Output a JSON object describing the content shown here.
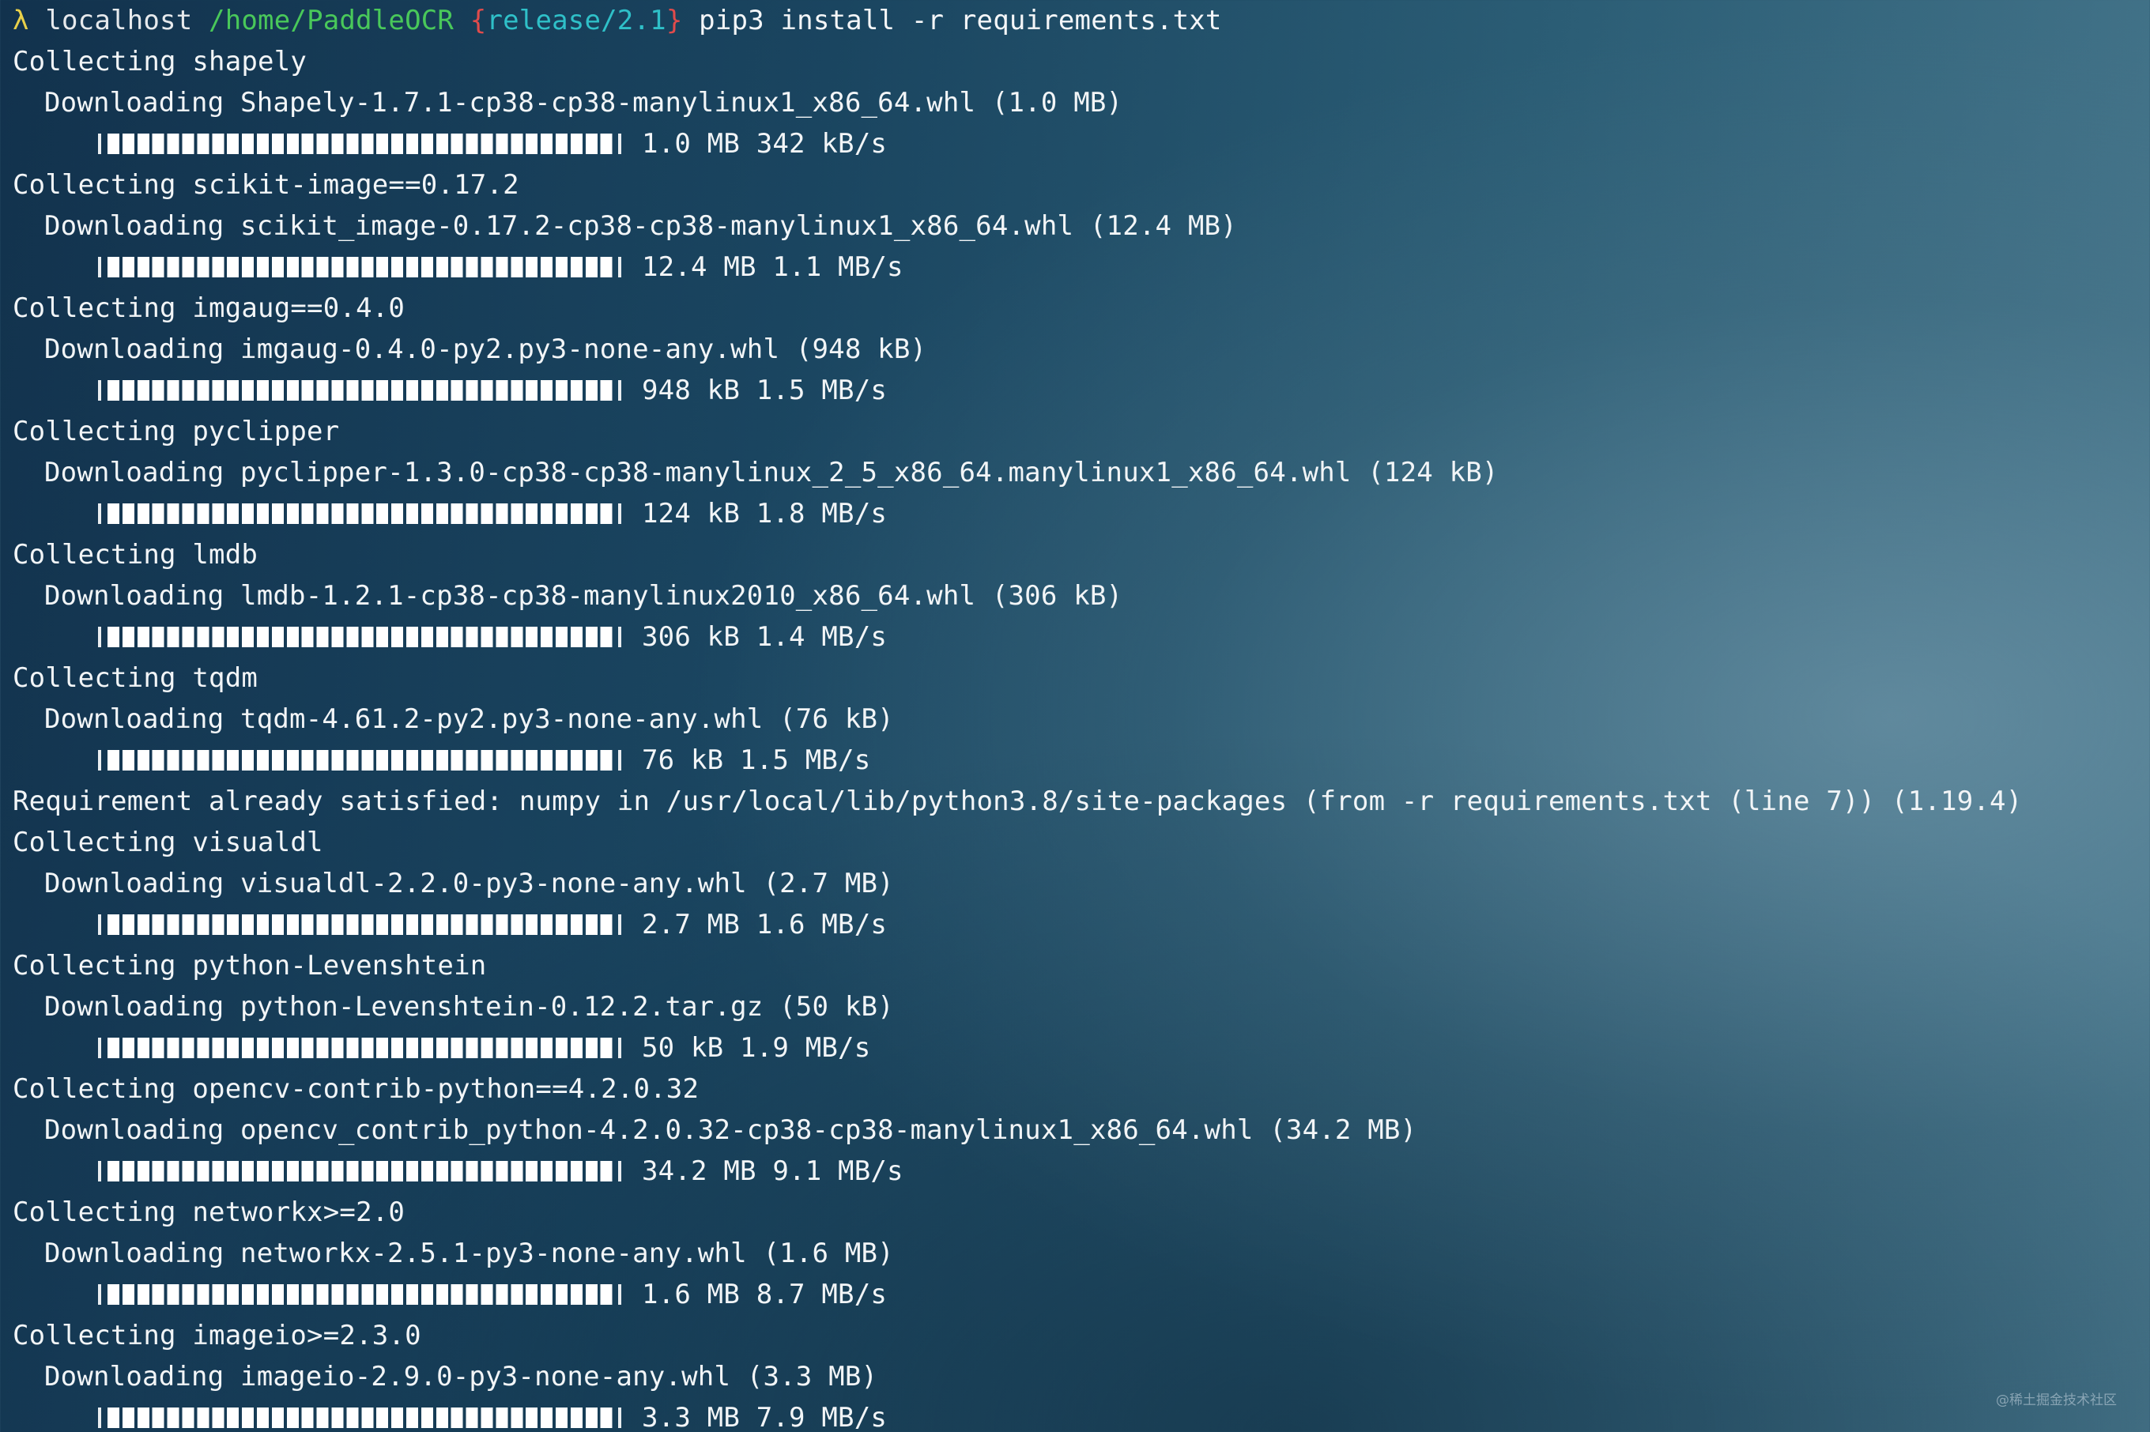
{
  "prompt": {
    "lambda": "λ",
    "host": "localhost",
    "path": "/home/PaddleOCR",
    "brace_open": "{",
    "branch": "release/2.1",
    "brace_close": "}",
    "command": "pip3 install -r requirements.txt"
  },
  "lines": [
    {
      "type": "collect",
      "text": "Collecting shapely"
    },
    {
      "type": "download",
      "text": "Downloading Shapely-1.7.1-cp38-cp38-manylinux1_x86_64.whl (1.0 MB)"
    },
    {
      "type": "bar",
      "stats": "1.0 MB 342 kB/s",
      "progress": 1.0
    },
    {
      "type": "collect",
      "text": "Collecting scikit-image==0.17.2"
    },
    {
      "type": "download",
      "text": "Downloading scikit_image-0.17.2-cp38-cp38-manylinux1_x86_64.whl (12.4 MB)"
    },
    {
      "type": "bar",
      "stats": "12.4 MB 1.1 MB/s",
      "progress": 1.0
    },
    {
      "type": "collect",
      "text": "Collecting imgaug==0.4.0"
    },
    {
      "type": "download",
      "text": "Downloading imgaug-0.4.0-py2.py3-none-any.whl (948 kB)"
    },
    {
      "type": "bar",
      "stats": "948 kB 1.5 MB/s",
      "progress": 1.0
    },
    {
      "type": "collect",
      "text": "Collecting pyclipper"
    },
    {
      "type": "download",
      "text": "Downloading pyclipper-1.3.0-cp38-cp38-manylinux_2_5_x86_64.manylinux1_x86_64.whl (124 kB)"
    },
    {
      "type": "bar",
      "stats": "124 kB 1.8 MB/s",
      "progress": 1.0
    },
    {
      "type": "collect",
      "text": "Collecting lmdb"
    },
    {
      "type": "download",
      "text": "Downloading lmdb-1.2.1-cp38-cp38-manylinux2010_x86_64.whl (306 kB)"
    },
    {
      "type": "bar",
      "stats": "306 kB 1.4 MB/s",
      "progress": 1.0
    },
    {
      "type": "collect",
      "text": "Collecting tqdm"
    },
    {
      "type": "download",
      "text": "Downloading tqdm-4.61.2-py2.py3-none-any.whl (76 kB)"
    },
    {
      "type": "bar",
      "stats": "76 kB 1.5 MB/s",
      "progress": 1.0
    },
    {
      "type": "collect",
      "text": "Requirement already satisfied: numpy in /usr/local/lib/python3.8/site-packages (from -r requirements.txt (line 7)) (1.19.4)"
    },
    {
      "type": "collect",
      "text": "Collecting visualdl"
    },
    {
      "type": "download",
      "text": "Downloading visualdl-2.2.0-py3-none-any.whl (2.7 MB)"
    },
    {
      "type": "bar",
      "stats": "2.7 MB 1.6 MB/s",
      "progress": 1.0
    },
    {
      "type": "collect",
      "text": "Collecting python-Levenshtein"
    },
    {
      "type": "download",
      "text": "Downloading python-Levenshtein-0.12.2.tar.gz (50 kB)"
    },
    {
      "type": "bar",
      "stats": "50 kB 1.9 MB/s",
      "progress": 1.0
    },
    {
      "type": "collect",
      "text": "Collecting opencv-contrib-python==4.2.0.32"
    },
    {
      "type": "download",
      "text": "Downloading opencv_contrib_python-4.2.0.32-cp38-cp38-manylinux1_x86_64.whl (34.2 MB)"
    },
    {
      "type": "bar",
      "stats": "34.2 MB 9.1 MB/s",
      "progress": 1.0
    },
    {
      "type": "collect",
      "text": "Collecting networkx>=2.0"
    },
    {
      "type": "download",
      "text": "Downloading networkx-2.5.1-py3-none-any.whl (1.6 MB)"
    },
    {
      "type": "bar",
      "stats": "1.6 MB 8.7 MB/s",
      "progress": 1.0
    },
    {
      "type": "collect",
      "text": "Collecting imageio>=2.3.0"
    },
    {
      "type": "download",
      "text": "Downloading imageio-2.9.0-py3-none-any.whl (3.3 MB)"
    },
    {
      "type": "bar",
      "stats": "3.3 MB 7.9 MB/s",
      "progress": 1.0
    }
  ],
  "watermark": "@稀土掘金技术社区"
}
